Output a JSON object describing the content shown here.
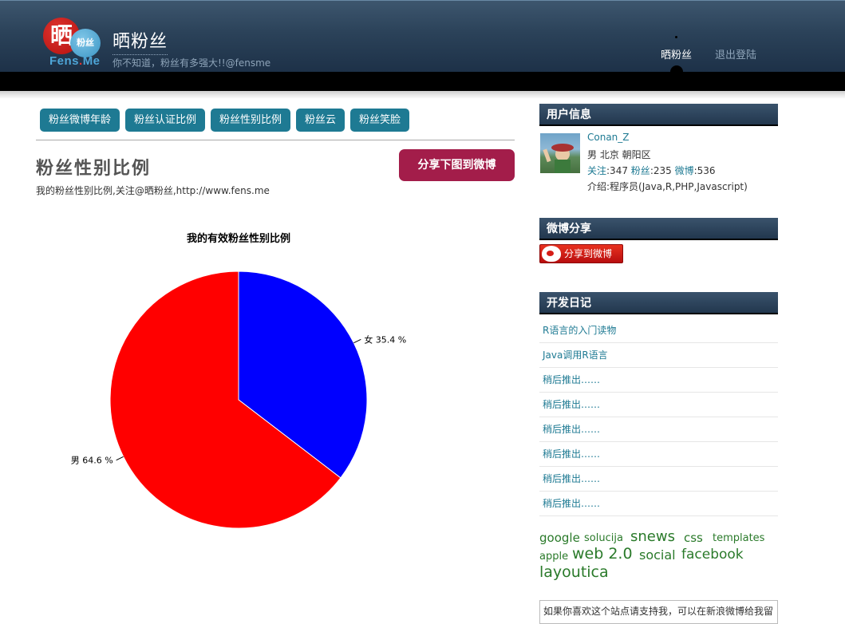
{
  "header": {
    "logo": {
      "glyph": "晒",
      "badge": "粉丝",
      "brand_left": "Fens",
      "brand_dot": ".",
      "brand_right": "Me"
    },
    "site_title": "晒粉丝",
    "slogan": "你不知道，粉丝有多强大!!@fensme",
    "nav": {
      "home": "晒粉丝",
      "logout": "退出登陆"
    }
  },
  "tabs": [
    "粉丝微博年龄",
    "粉丝认证比例",
    "粉丝性别比例",
    "粉丝云",
    "粉丝笑脸"
  ],
  "main": {
    "title": "粉丝性别比例",
    "subtitle": "我的粉丝性别比例,关注@晒粉丝,http://www.fens.me",
    "share_button": "分享下图到微博"
  },
  "chart_data": {
    "type": "pie",
    "title": "我的有效粉丝性别比例",
    "slices": [
      {
        "name": "女",
        "value": 35.4,
        "label": "女 35.4 %",
        "color": "#0000ff"
      },
      {
        "name": "男",
        "value": 64.6,
        "label": "男 64.6 %",
        "color": "#ff0000"
      }
    ]
  },
  "sidebar": {
    "user_info": {
      "heading": "用户信息",
      "name": "Conan_Z",
      "location": "男  北京 朝阳区",
      "follow_label": "关注",
      "follow_count": ":347",
      "fans_label": "粉丝",
      "fans_count": ":235",
      "weibo_label": "微博",
      "weibo_count": ":536",
      "intro": "介绍:程序员(Java,R,PHP,Javascript)"
    },
    "weibo_share": {
      "heading": "微博分享",
      "button": "分享到微博"
    },
    "dev_log": {
      "heading": "开发日记",
      "items": [
        "R语言的入门读物",
        "Java调用R语言",
        "稍后推出……",
        "稍后推出……",
        "稍后推出……",
        "稍后推出……",
        "稍后推出……",
        "稍后推出……"
      ]
    },
    "tags": [
      "google",
      "solucija",
      "snews",
      "css",
      "templates",
      "apple",
      "web 2.0",
      "social",
      "facebook",
      "layoutica"
    ],
    "note": "如果你喜欢这个站点请支持我，可以在新浪微博给我留"
  }
}
